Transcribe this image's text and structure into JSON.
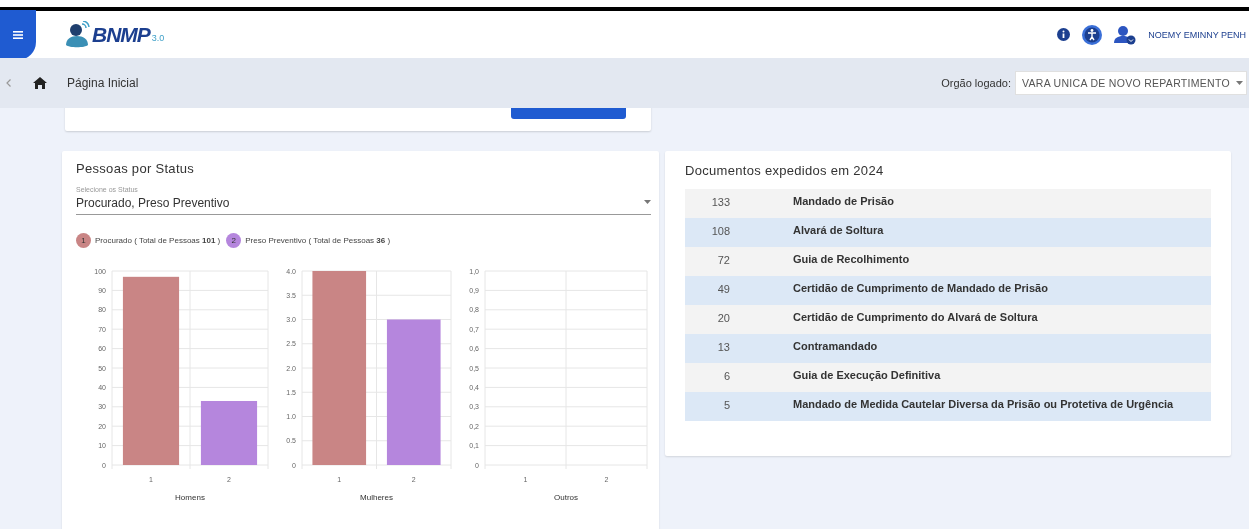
{
  "header": {
    "logo_text": "BNMP",
    "logo_version": "3.0",
    "user_name": "NOEMY EMINNY PENH"
  },
  "breadcrumb": {
    "page": "Página Inicial",
    "org_label": "Orgão logado:",
    "org_value": "VARA UNICA DE NOVO REPARTIMENTO"
  },
  "status_card": {
    "title": "Pessoas por Status",
    "select_label": "Selecione os Status",
    "select_value": "Procurado, Preso Preventivo",
    "legend": [
      {
        "number": "1",
        "label": "Procurado ( Total de Pessoas ",
        "total": "101",
        "end": " )",
        "color": "#c98585"
      },
      {
        "number": "2",
        "label": "Preso Preventivo ( Total de Pessoas ",
        "total": "36",
        "end": " )",
        "color": "#b586dd"
      }
    ],
    "charts": [
      {
        "chart_data": {
          "type": "bar",
          "xlabel": "Homens",
          "categories": [
            "1",
            "2"
          ],
          "ylim": [
            0,
            100
          ],
          "yticks": [
            0,
            10,
            20,
            30,
            40,
            50,
            60,
            70,
            80,
            90,
            100
          ],
          "grid": true,
          "values": [
            97,
            33
          ]
        }
      },
      {
        "chart_data": {
          "type": "bar",
          "xlabel": "Mulheres",
          "categories": [
            "1",
            "2"
          ],
          "ylim": [
            0,
            4
          ],
          "yticks": [
            {
              "value": 0,
              "label": "0"
            },
            {
              "value": 0.5,
              "label": "0.5"
            },
            {
              "value": 1,
              "label": "1.0"
            },
            {
              "value": 1.5,
              "label": "1.5"
            },
            {
              "value": 2,
              "label": "2.0"
            },
            {
              "value": 2.5,
              "label": "2.5"
            },
            {
              "value": 3,
              "label": "3.0"
            },
            {
              "value": 3.5,
              "label": "3.5"
            },
            {
              "value": 4,
              "label": "4.0"
            }
          ],
          "grid": true,
          "values": [
            4,
            3
          ]
        }
      },
      {
        "chart_data": {
          "type": "bar",
          "xlabel": "Outros",
          "categories": [
            "1",
            "2"
          ],
          "ylim": [
            0,
            1
          ],
          "yticks": [
            {
              "value": 0,
              "label": "0"
            },
            {
              "value": 0.1,
              "label": "0,1"
            },
            {
              "value": 0.2,
              "label": "0,2"
            },
            {
              "value": 0.3,
              "label": "0,3"
            },
            {
              "value": 0.4,
              "label": "0,4"
            },
            {
              "value": 0.5,
              "label": "0,5"
            },
            {
              "value": 0.6,
              "label": "0,6"
            },
            {
              "value": 0.7,
              "label": "0,7"
            },
            {
              "value": 0.8,
              "label": "0,8"
            },
            {
              "value": 0.9,
              "label": "0,9"
            },
            {
              "value": 1,
              "label": "1,0"
            }
          ],
          "grid": true,
          "values": [
            null,
            null
          ]
        }
      }
    ]
  },
  "documents_card": {
    "title": "Documentos expedidos em 2024",
    "rows": [
      {
        "count": "133",
        "name": "Mandado de Prisão"
      },
      {
        "count": "108",
        "name": "Alvará de Soltura"
      },
      {
        "count": "72",
        "name": "Guia de Recolhimento"
      },
      {
        "count": "49",
        "name": "Certidão de Cumprimento de Mandado de Prisão"
      },
      {
        "count": "20",
        "name": "Certidão de Cumprimento do Alvará de Soltura"
      },
      {
        "count": "13",
        "name": "Contramandado"
      },
      {
        "count": "6",
        "name": "Guia de Execução Definitiva"
      },
      {
        "count": "5",
        "name": "Mandado de Medida Cautelar Diversa da Prisão ou Protetiva de Urgência"
      }
    ]
  }
}
